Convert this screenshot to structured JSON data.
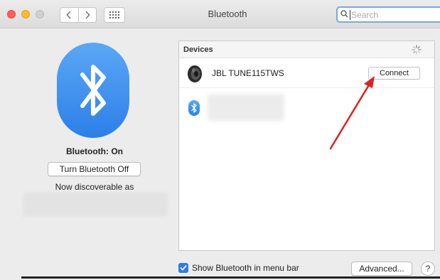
{
  "window": {
    "title": "Bluetooth",
    "search": {
      "placeholder": "Search"
    }
  },
  "toolbar": {
    "back_icon": "chevron-left-icon",
    "forward_icon": "chevron-right-icon",
    "grid_icon": "show-all-grid-icon"
  },
  "left_panel": {
    "status": "Bluetooth: On",
    "toggle_label": "Turn Bluetooth Off",
    "discoverable_label": "Now discoverable as"
  },
  "devices": {
    "header": "Devices",
    "items": [
      {
        "name": "JBL TUNE115TWS",
        "icon": "speaker-icon",
        "action": "Connect"
      },
      {
        "name": "",
        "icon": "bluetooth-icon"
      }
    ]
  },
  "footer": {
    "show_in_menu_bar_label": "Show Bluetooth in menu bar",
    "show_in_menu_bar_checked": true,
    "advanced_label": "Advanced...",
    "help_label": "?"
  },
  "colors": {
    "accent": "#2f7de3",
    "annotation_arrow": "#e02020"
  }
}
